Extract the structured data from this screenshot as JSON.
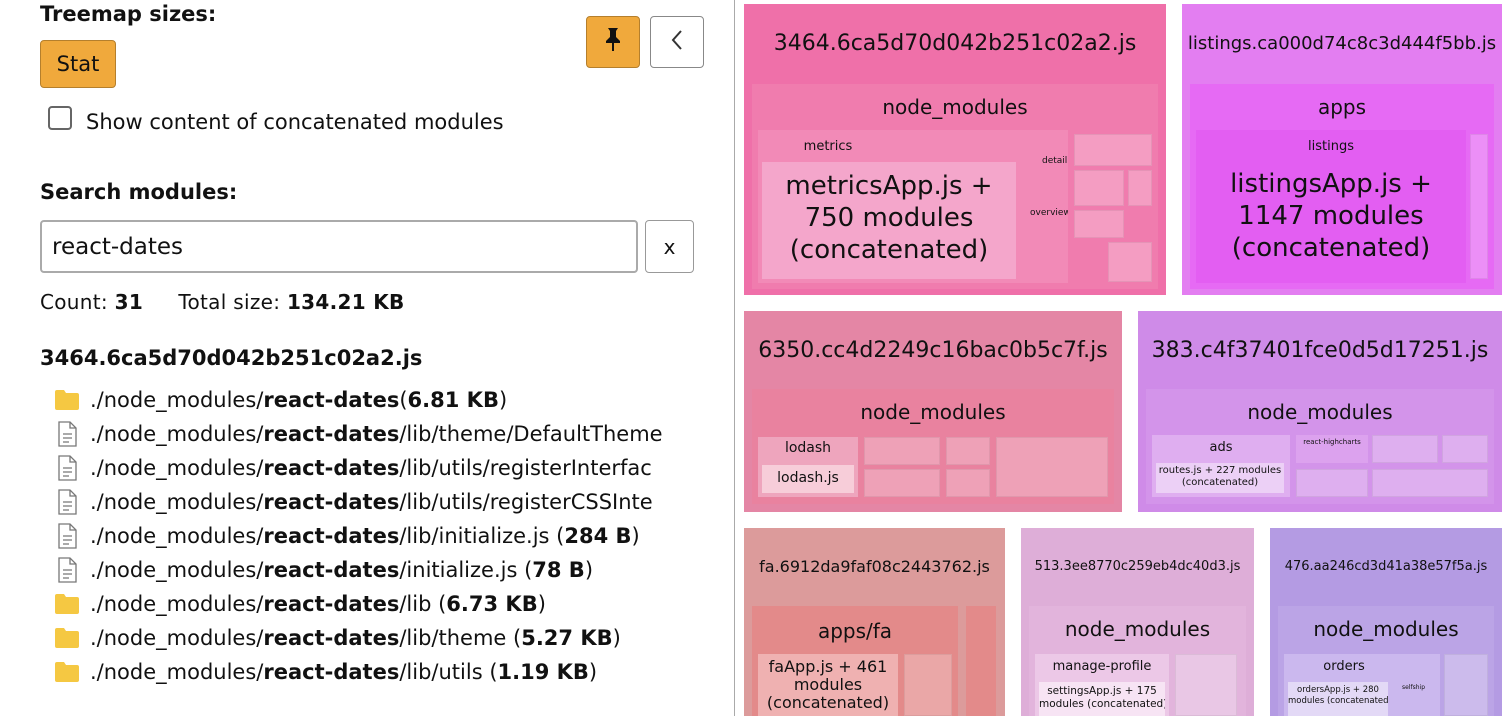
{
  "sidebar": {
    "treemap_sizes_title": "Treemap sizes:",
    "stat_button": "Stat",
    "pin_icon": "pin-icon",
    "back_icon": "chevron-left-icon",
    "concat_checkbox_label": "Show content of concatenated modules",
    "concat_checkbox_checked": false,
    "search_title": "Search modules:",
    "search_value": "react-dates",
    "clear_button": "x",
    "count_label": "Count:",
    "count_value": "31",
    "total_label": "Total size:",
    "total_value": "134.21 KB",
    "chunk_title": "3464.6ca5d70d042b251c02a2.js",
    "results": [
      {
        "icon": "folder-icon",
        "prefix": "./node_modules/",
        "match": "react-dates",
        "suffix": " (",
        "size": "6.81 KB",
        "close": ")"
      },
      {
        "icon": "file-icon",
        "prefix": "./node_modules/",
        "match": "react-dates",
        "suffix": "/lib/theme/DefaultTheme",
        "size": "",
        "close": ""
      },
      {
        "icon": "file-icon",
        "prefix": "./node_modules/",
        "match": "react-dates",
        "suffix": "/lib/utils/registerInterfac",
        "size": "",
        "close": ""
      },
      {
        "icon": "file-icon",
        "prefix": "./node_modules/",
        "match": "react-dates",
        "suffix": "/lib/utils/registerCSSInte",
        "size": "",
        "close": ""
      },
      {
        "icon": "file-icon",
        "prefix": "./node_modules/",
        "match": "react-dates",
        "suffix": "/lib/initialize.js (",
        "size": "284 B",
        "close": ")"
      },
      {
        "icon": "file-icon",
        "prefix": "./node_modules/",
        "match": "react-dates",
        "suffix": "/initialize.js (",
        "size": "78 B",
        "close": ")"
      },
      {
        "icon": "folder-icon",
        "prefix": "./node_modules/",
        "match": "react-dates",
        "suffix": "/lib (",
        "size": "6.73 KB",
        "close": ")"
      },
      {
        "icon": "folder-icon",
        "prefix": "./node_modules/",
        "match": "react-dates",
        "suffix": "/lib/theme (",
        "size": "5.27 KB",
        "close": ")"
      },
      {
        "icon": "folder-icon",
        "prefix": "./node_modules/",
        "match": "react-dates",
        "suffix": "/lib/utils (",
        "size": "1.19 KB",
        "close": ")"
      }
    ]
  },
  "treemap": {
    "chunk1": {
      "name": "3464.6ca5d70d042b251c02a2.js",
      "group": "node_modules",
      "sub": "metrics",
      "concat_lines": [
        "metricsApp.js +",
        "750 modules",
        "(concatenated)"
      ],
      "labels": [
        "detail",
        "overview",
        "..."
      ],
      "color": "#ef70a9"
    },
    "chunk2": {
      "name": "listings.ca000d74c8c3d444f5bb.js",
      "group": "apps",
      "sub": "listings",
      "concat_lines": [
        "listingsApp.js +",
        "1147 modules",
        "(concatenated)"
      ],
      "color": "#e37ef1"
    },
    "chunk3": {
      "name": "6350.cc4d2249c16bac0b5c7f.js",
      "group": "node_modules",
      "sub": "lodash",
      "leaf": "lodash.js",
      "color": "#e486a5"
    },
    "chunk4": {
      "name": "383.c4f37401fce0d5d17251.js",
      "group": "node_modules",
      "sub": "ads",
      "sub2": "react-highcharts",
      "concat_lines": [
        "routes.js + 227 modules",
        "(concatenated)"
      ],
      "color": "#cf8be8"
    },
    "chunk5": {
      "name": "fa.6912da9faf08c2443762.js",
      "group": "apps/fa",
      "concat_lines": [
        "faApp.js + 461",
        "modules",
        "(concatenated)"
      ],
      "color": "#dc9b9b"
    },
    "chunk6": {
      "name": "513.3ee8770c259eb4dc40d3.js",
      "group": "node_modules",
      "sub": "manage-profile",
      "concat_lines": [
        "settingsApp.js + 175",
        "modules (concatenated)"
      ],
      "color": "#deaed8"
    },
    "chunk7": {
      "name": "476.aa246cd3d41a38e57f5a.js",
      "group": "node_modules",
      "sub": "orders",
      "sub2": "selfship",
      "concat_lines": [
        "ordersApp.js + 280",
        "modules (concatenated)"
      ],
      "color": "#b49be3"
    },
    "ellipsis": "..."
  }
}
